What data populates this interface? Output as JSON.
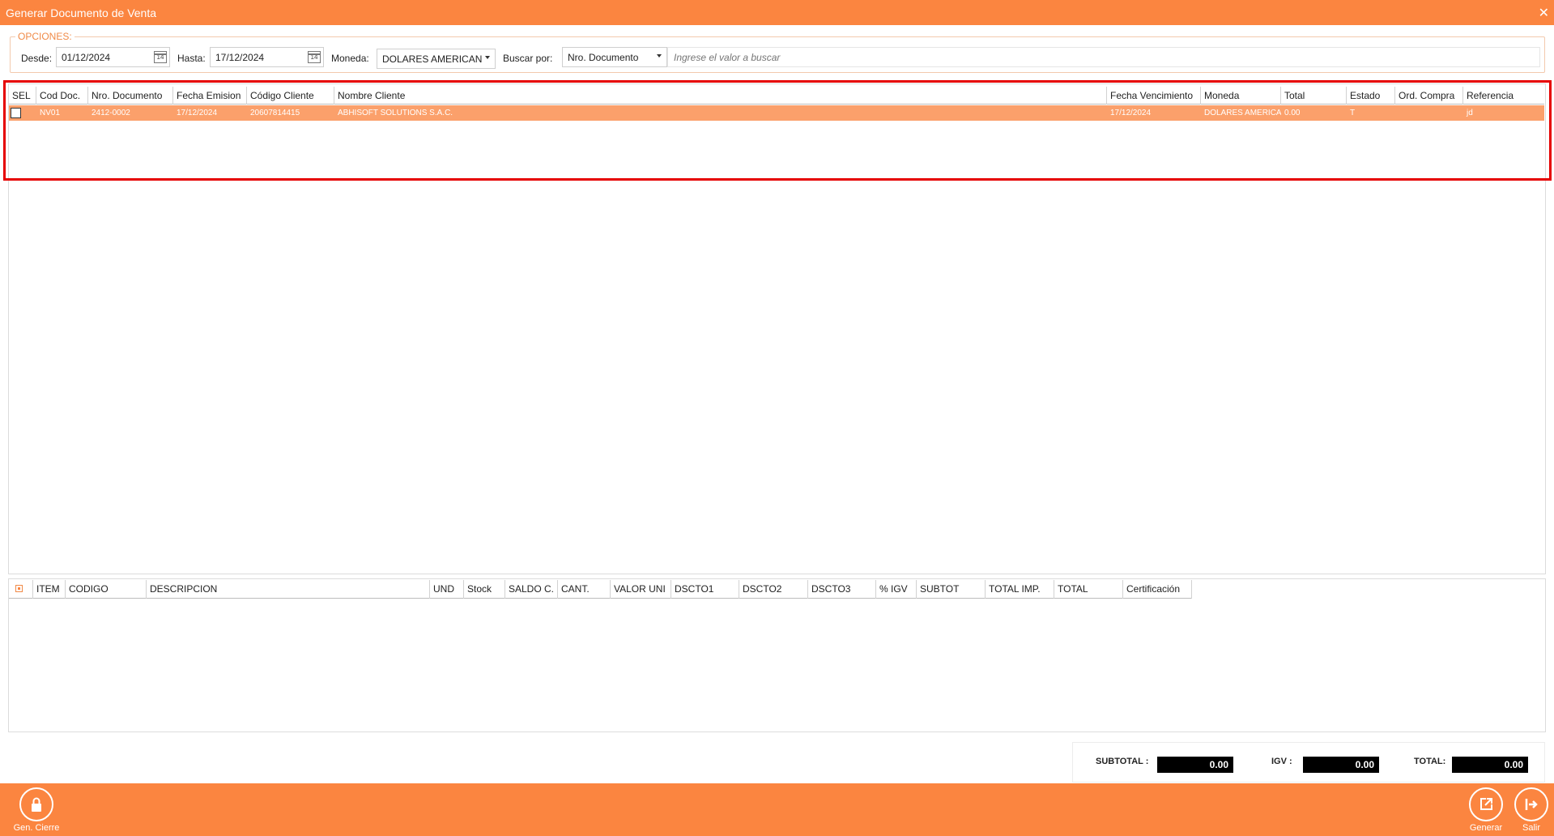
{
  "window": {
    "title": "Generar Documento de Venta"
  },
  "options": {
    "legend": "OPCIONES:",
    "desde_label": "Desde:",
    "desde_value": "01/12/2024",
    "hasta_label": "Hasta:",
    "hasta_value": "17/12/2024",
    "moneda_label": "Moneda:",
    "moneda_value": "DOLARES AMERICAN",
    "buscar_label": "Buscar por:",
    "buscar_value": "Nro. Documento",
    "search_placeholder": "Ingrese el valor a buscar",
    "calendar_day": "14"
  },
  "documents": {
    "columns": [
      "SEL",
      "Cod Doc.",
      "Nro. Documento",
      "Fecha Emision",
      "Código Cliente",
      "Nombre Cliente",
      "Fecha Vencimiento",
      "Moneda",
      "Total",
      "Estado",
      "Ord. Compra",
      "Referencia"
    ],
    "rows": [
      {
        "cod": "NV01",
        "nro": "2412-0002",
        "emision": "17/12/2024",
        "codcli": "20607814415",
        "nombre": "ABHISOFT SOLUTIONS S.A.C.",
        "venc": "17/12/2024",
        "moneda": "DOLARES AMERICA",
        "total": "0.00",
        "estado": "T",
        "oc": "",
        "ref": "jd"
      }
    ]
  },
  "details": {
    "columns": [
      "ITEM",
      "CODIGO",
      "DESCRIPCION",
      "UND",
      "Stock",
      "SALDO C.",
      "CANT.",
      "VALOR UNI",
      "DSCTO1",
      "DSCTO2",
      "DSCTO3",
      "% IGV",
      "SUBTOT",
      "TOTAL IMP.",
      "TOTAL",
      "Certificación"
    ]
  },
  "totals": {
    "subtotal_label": "SUBTOTAL :",
    "subtotal_value": "0.00",
    "igv_label": "IGV :",
    "igv_value": "0.00",
    "total_label": "TOTAL:",
    "total_value": "0.00"
  },
  "toolbar": {
    "gen_cierre_label": "Gen. Cierre",
    "generar_label": "Generar",
    "salir_label": "Salir"
  },
  "colors": {
    "accent": "#fb8540",
    "selected_row": "#fba06b",
    "highlight": "#e60000"
  }
}
